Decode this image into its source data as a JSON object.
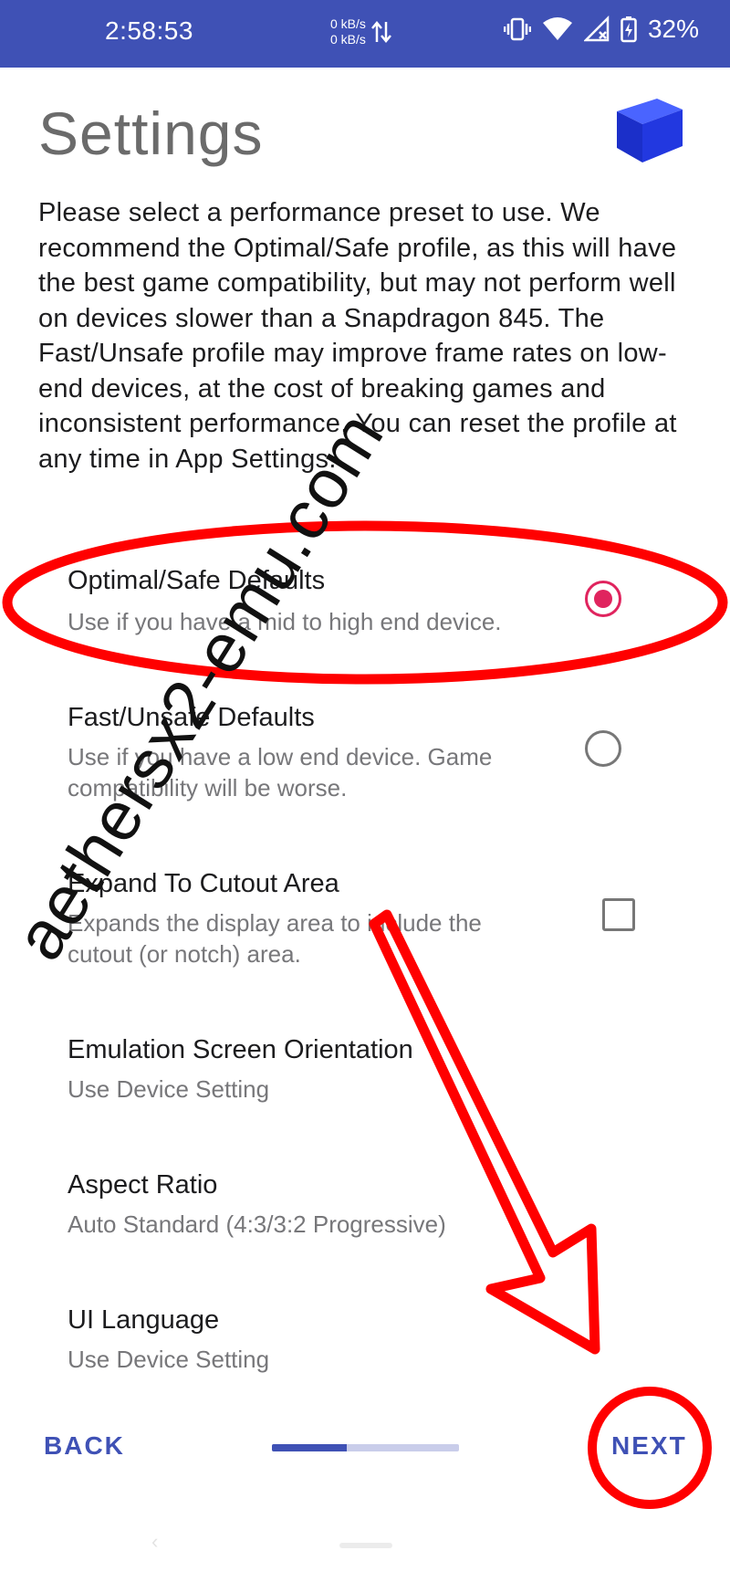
{
  "status_bar": {
    "time": "2:58:53",
    "net_up": "0 kB/s",
    "net_down": "0 kB/s",
    "battery": "32%",
    "icons": [
      "vibrate-icon",
      "wifi-icon",
      "signal-icon",
      "battery-icon"
    ]
  },
  "header": {
    "title": "Settings",
    "logo_icon": "blue-cube-icon"
  },
  "description": "Please select a performance preset to use. We recommend the Optimal/Safe profile, as this will have the best game compatibility, but may not perform well on devices slower than a Snapdragon 845. The Fast/Unsafe profile may improve frame rates on low-end devices, at the cost of breaking games and inconsistent performance. You can reset the profile at any time in App Settings.",
  "options": [
    {
      "title": "Optimal/Safe Defaults",
      "subtitle": "Use if you have a mid to high end device.",
      "control": "radio",
      "checked": true
    },
    {
      "title": "Fast/Unsafe Defaults",
      "subtitle": "Use if you have a low end device. Game compatibility will be worse.",
      "control": "radio",
      "checked": false
    },
    {
      "title": "Expand To Cutout Area",
      "subtitle": "Expands the display area to include the cutout (or notch) area.",
      "control": "checkbox",
      "checked": false
    },
    {
      "title": "Emulation Screen Orientation",
      "subtitle": "Use Device Setting"
    },
    {
      "title": "Aspect Ratio",
      "subtitle": "Auto Standard (4:3/3:2 Progressive)"
    },
    {
      "title": "UI Language",
      "subtitle": "Use Device Setting"
    }
  ],
  "footer": {
    "back_label": "BACK",
    "next_label": "NEXT",
    "progress": 0.4
  },
  "nav_hint": {
    "back_glyph": "‹"
  },
  "watermark": "aethersx2-emu.com",
  "colors": {
    "accent": "#3f51b5",
    "radio_checked": "#e0245e",
    "annotation_red": "#ff0000"
  }
}
